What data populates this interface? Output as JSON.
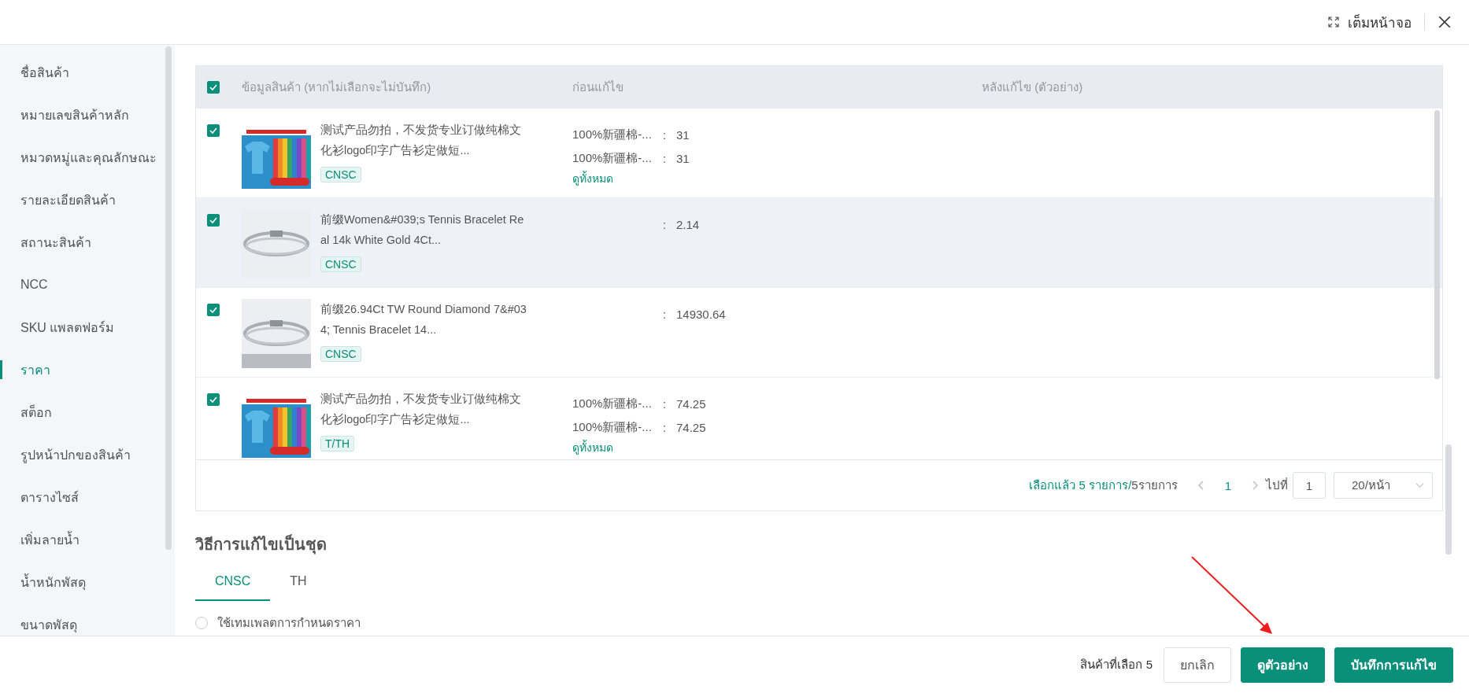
{
  "header": {
    "fullscreen_label": "เต็มหน้าจอ"
  },
  "sidebar": {
    "items": [
      {
        "label": "ชื่อสินค้า",
        "selected": false
      },
      {
        "label": "หมายเลขสินค้าหลัก",
        "selected": false
      },
      {
        "label": "หมวดหมู่และคุณลักษณะ",
        "selected": false
      },
      {
        "label": "รายละเอียดสินค้า",
        "selected": false
      },
      {
        "label": "สถานะสินค้า",
        "selected": false
      },
      {
        "label": "NCC",
        "selected": false
      },
      {
        "label": "SKU แพลตฟอร์ม",
        "selected": false
      },
      {
        "label": "ราคา",
        "selected": true
      },
      {
        "label": "สต็อก",
        "selected": false
      },
      {
        "label": "รูปหน้าปกของสินค้า",
        "selected": false
      },
      {
        "label": "ตารางไซส์",
        "selected": false
      },
      {
        "label": "เพิ่มลายน้ำ",
        "selected": false
      },
      {
        "label": "น้ำหนักพัสดุ",
        "selected": false
      },
      {
        "label": "ขนาดพัสดุ",
        "selected": false
      }
    ]
  },
  "table": {
    "select_all_checked": true,
    "columns": [
      "ข้อมูลสินค้า (หากไม่เลือกจะไม่บันทึก)",
      "ก่อนแก้ไข",
      "หลังแก้ไข (ตัวอย่าง)"
    ],
    "rows": [
      {
        "checked": true,
        "highlighted": false,
        "image": {
          "kind": "picture"
        },
        "name": "测试产品勿拍，不发货专业订做纯棉文化衫logo印字广告衫定做短...",
        "tag": "CNSC",
        "variants": [
          {
            "label": "100%新疆棉-...",
            "separator": ":",
            "value": "31"
          },
          {
            "label": "100%新疆棉-...",
            "separator": ":",
            "value": "31"
          }
        ],
        "view_all": "ดูทั้งหมด"
      },
      {
        "checked": true,
        "highlighted": true,
        "image": {
          "kind": "picture"
        },
        "name": "前缀Women&#039;s Tennis Bracelet Real 14k White Gold 4Ct...",
        "tag": "CNSC",
        "variants": [
          {
            "separator": ":",
            "value": "2.14"
          }
        ]
      },
      {
        "checked": true,
        "highlighted": false,
        "image": {
          "kind": "picture"
        },
        "name": "前缀26.94Ct TW Round Diamond 7&#034; Tennis Bracelet 14...",
        "tag": "CNSC",
        "variants": [
          {
            "separator": ":",
            "value": "14930.64"
          }
        ]
      },
      {
        "checked": true,
        "highlighted": false,
        "image": {
          "kind": "picture"
        },
        "name": "测试产品勿拍，不发货专业订做纯棉文化衫logo印字广告衫定做短...",
        "tag": "T/TH",
        "variants": [
          {
            "label": "100%新疆棉-...",
            "separator": ":",
            "value": "74.25"
          },
          {
            "label": "100%新疆棉-...",
            "separator": ":",
            "value": "74.25"
          }
        ],
        "view_all": "ดูทั้งหมด"
      }
    ],
    "pagination": {
      "selected_text": "เลือกแล้ว 5 รายการ/",
      "total_text": "5รายการ",
      "current_page": "1",
      "goto_label": "ไปที่",
      "goto_value": "1",
      "page_size": "20/หน้า"
    }
  },
  "batch_section": {
    "title": "วิธีการแก้ไขเป็นชุด",
    "tabs": [
      {
        "label": "CNSC",
        "selected": true
      },
      {
        "label": "TH",
        "selected": false
      }
    ],
    "options": [
      {
        "label": "ใช้เทมเพลตการกำหนดราคา",
        "selected": false
      }
    ]
  },
  "footer": {
    "selected_count": "สินค้าที่เลือก 5",
    "cancel": "ยกเลิก",
    "preview": "ดูตัวอย่าง",
    "save": "บันทึกการแก้ไข"
  }
}
